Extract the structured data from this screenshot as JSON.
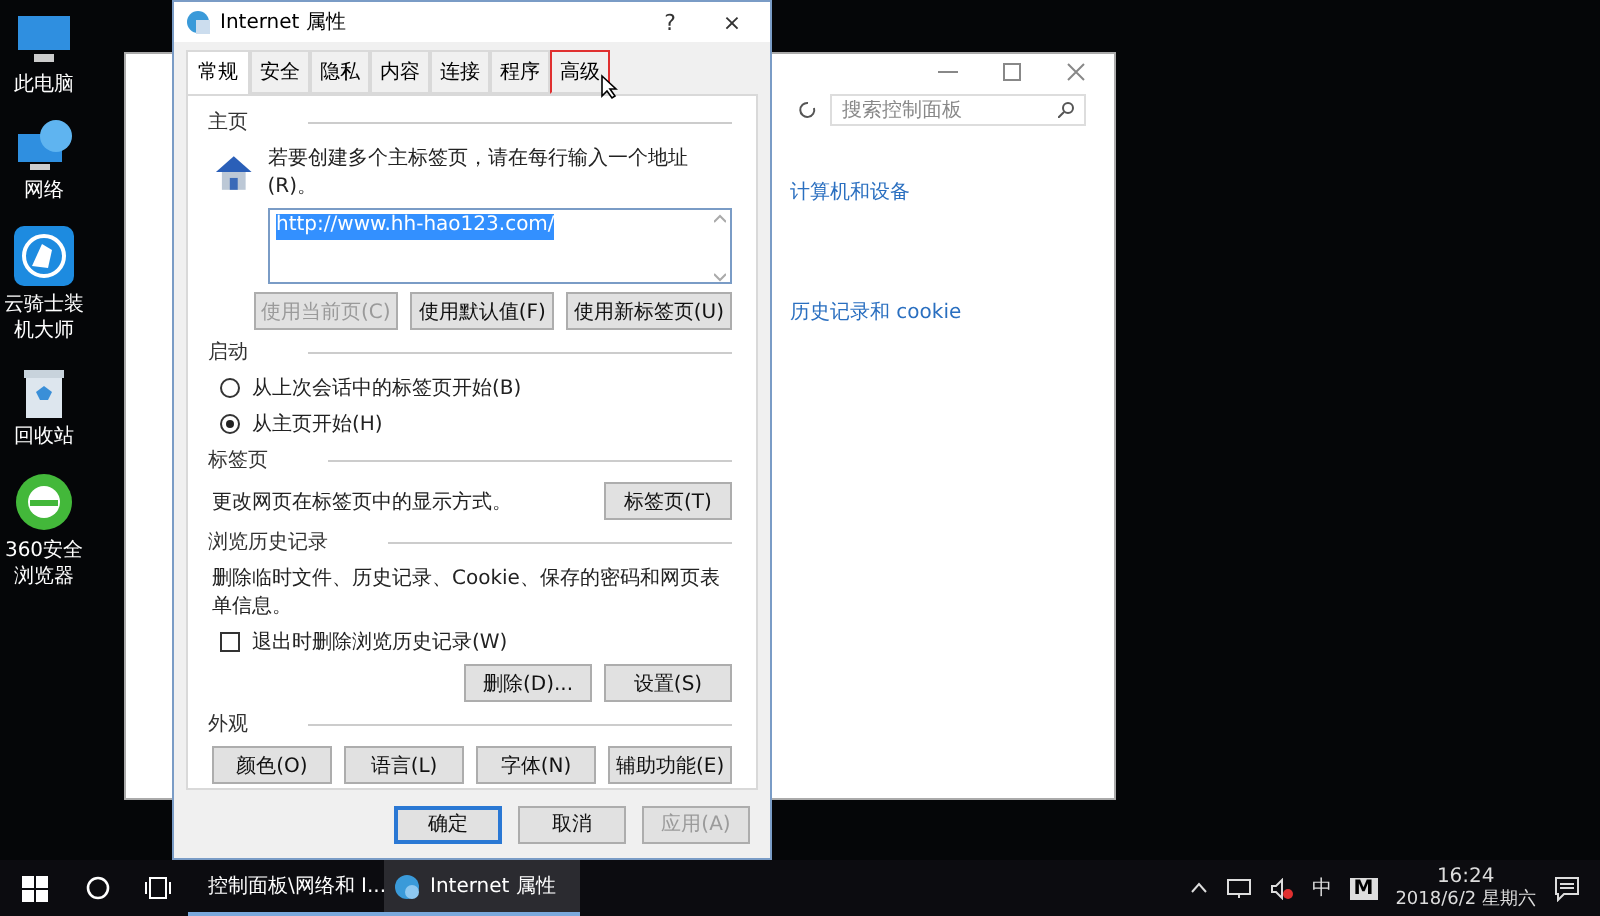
{
  "desktop_icons": [
    {
      "kind": "computer",
      "label": "此电脑"
    },
    {
      "kind": "network",
      "label": "网络"
    },
    {
      "kind": "knight",
      "label": "云骑士装机大师"
    },
    {
      "kind": "bin",
      "label": "回收站"
    },
    {
      "kind": "browser",
      "label": "360安全浏览器"
    }
  ],
  "background_window": {
    "search": {
      "placeholder": "搜索控制面板"
    },
    "links": [
      "计算机和设备",
      "历史记录和 cookie"
    ]
  },
  "dialog": {
    "title": "Internet 属性",
    "help": "?",
    "close": "×",
    "tabs": [
      {
        "label": "常规",
        "selected": true,
        "marked": false
      },
      {
        "label": "安全",
        "selected": false,
        "marked": false
      },
      {
        "label": "隐私",
        "selected": false,
        "marked": false
      },
      {
        "label": "内容",
        "selected": false,
        "marked": false
      },
      {
        "label": "连接",
        "selected": false,
        "marked": false
      },
      {
        "label": "程序",
        "selected": false,
        "marked": false
      },
      {
        "label": "高级",
        "selected": false,
        "marked": true
      }
    ],
    "homepage": {
      "heading": "主页",
      "hint": "若要创建多个主标签页，请在每行输入一个地址(R)。",
      "value": "http://www.hh-hao123.com/",
      "buttons": [
        {
          "label": "使用当前页(C)",
          "disabled": true
        },
        {
          "label": "使用默认值(F)",
          "disabled": false
        },
        {
          "label": "使用新标签页(U)",
          "disabled": false
        }
      ]
    },
    "startup": {
      "heading": "启动",
      "options": [
        {
          "label": "从上次会话中的标签页开始(B)",
          "selected": false
        },
        {
          "label": "从主页开始(H)",
          "selected": true
        }
      ]
    },
    "tabs_section": {
      "heading": "标签页",
      "text": "更改网页在标签页中的显示方式。",
      "button": "标签页(T)"
    },
    "history": {
      "heading": "浏览历史记录",
      "text": "删除临时文件、历史记录、Cookie、保存的密码和网页表单信息。",
      "checkbox": {
        "label": "退出时删除浏览历史记录(W)",
        "checked": false
      },
      "buttons": [
        "删除(D)...",
        "设置(S)"
      ]
    },
    "appearance": {
      "heading": "外观",
      "buttons": [
        "颜色(O)",
        "语言(L)",
        "字体(N)",
        "辅助功能(E)"
      ]
    },
    "footer": [
      {
        "label": "确定",
        "default": true,
        "disabled": false
      },
      {
        "label": "取消",
        "default": false,
        "disabled": false
      },
      {
        "label": "应用(A)",
        "default": false,
        "disabled": true
      }
    ]
  },
  "taskbar": {
    "tasks": [
      {
        "label": "控制面板\\网络和 I...",
        "active": false
      },
      {
        "label": "Internet 属性",
        "active": true
      }
    ],
    "tray": {
      "ime": "中",
      "ime_mode": "M",
      "time": "16:24",
      "date": "2018/6/2 星期六"
    }
  }
}
